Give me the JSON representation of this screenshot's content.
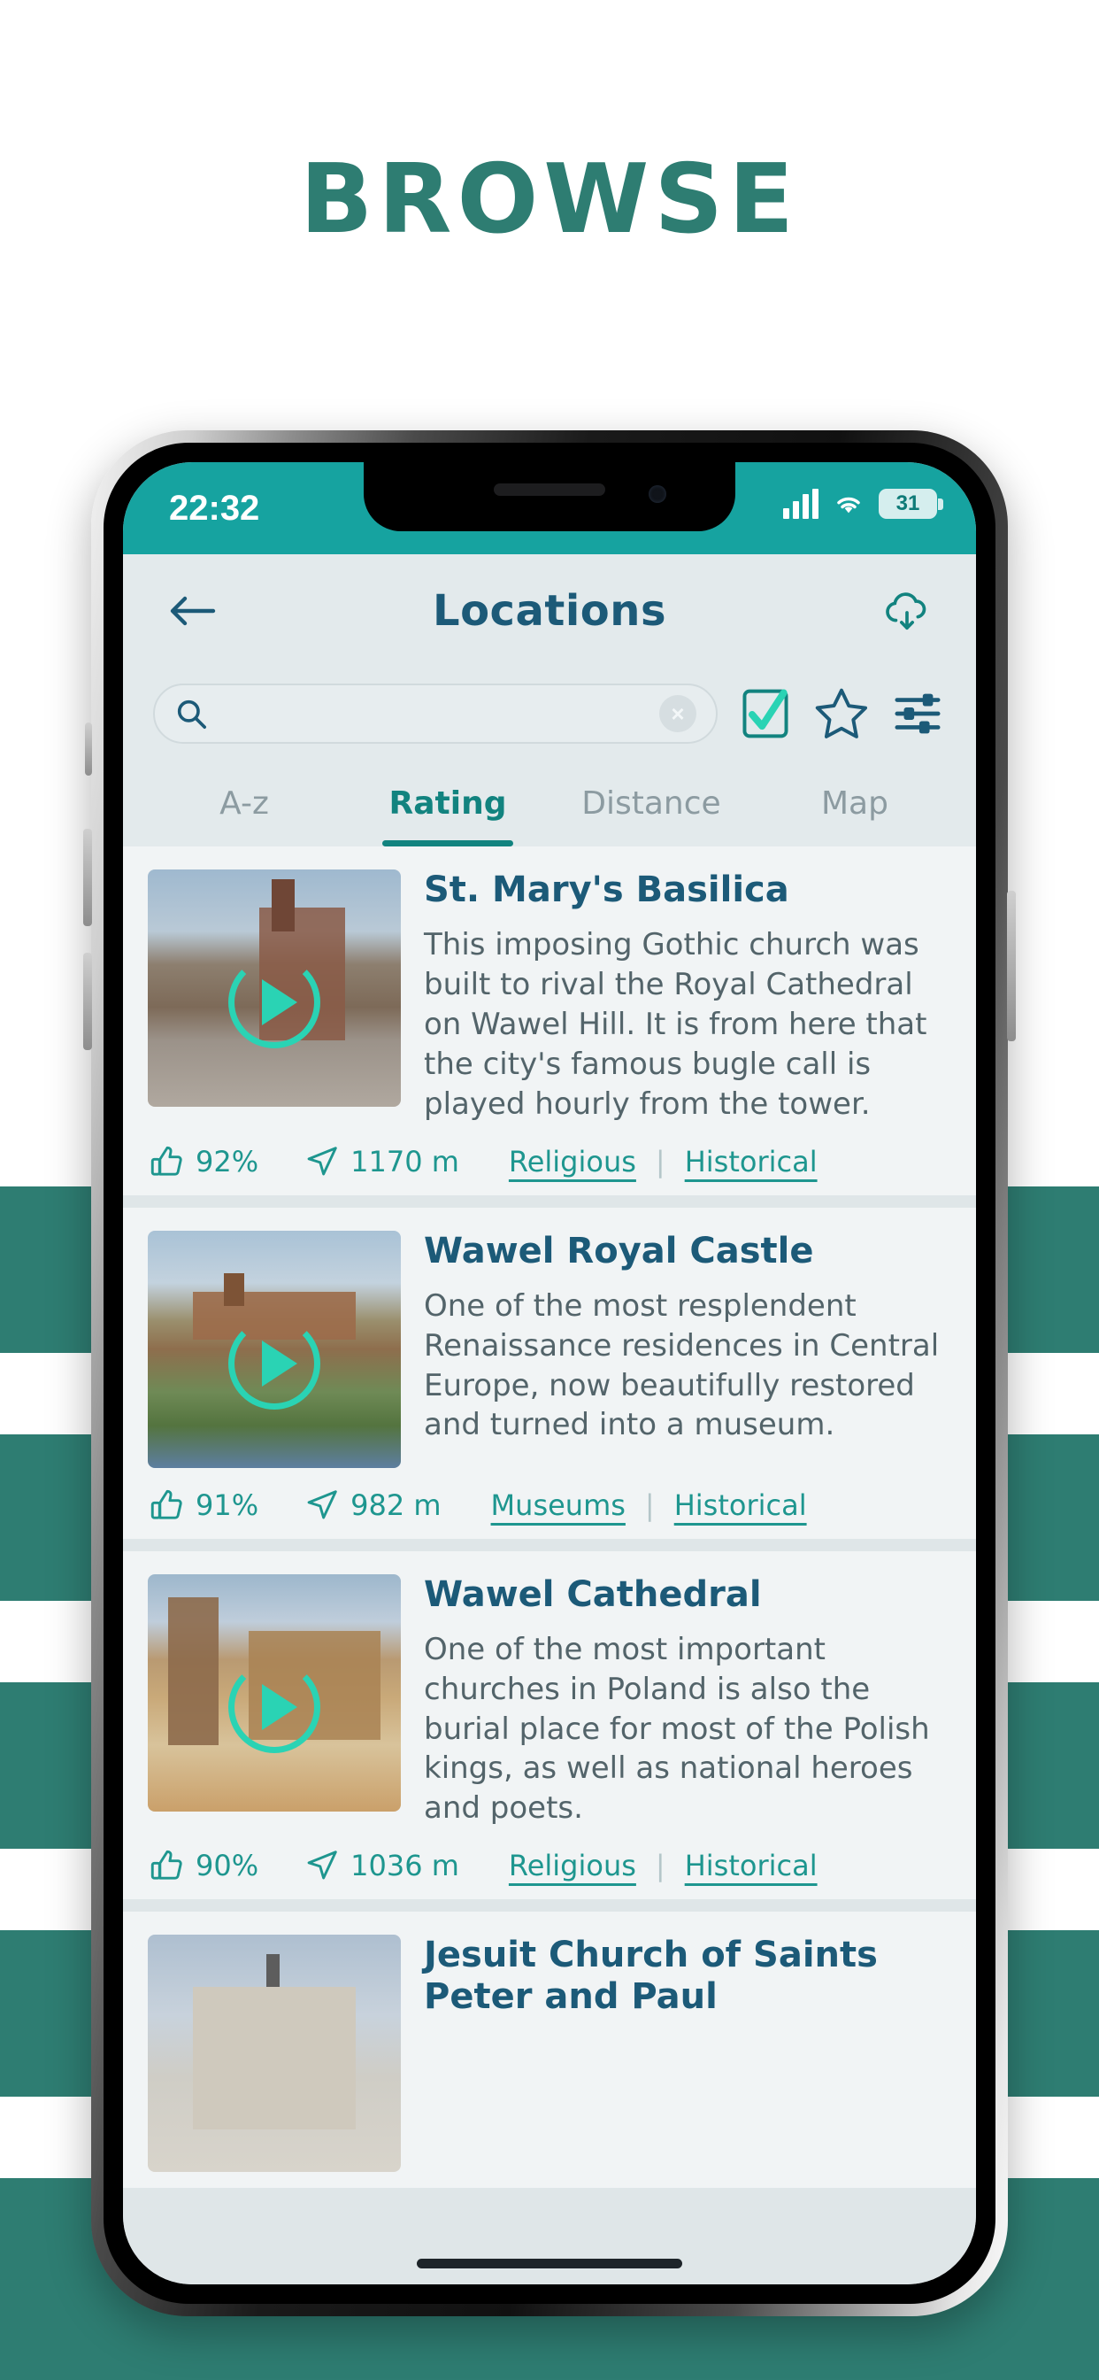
{
  "headline": "BROWSE",
  "theme": {
    "accent_teal": "#16a3a0",
    "dark_teal": "#2e7d72",
    "title_blue": "#1c5a78",
    "link_teal": "#1e968f",
    "screen_bg": "#e3eaec",
    "play_green": "#2ad3b4"
  },
  "status_bar": {
    "time": "22:32",
    "battery_level": "31",
    "signal_icon": "signal-bars-icon",
    "wifi_icon": "wifi-icon",
    "battery_icon": "battery-icon"
  },
  "app_bar": {
    "back_icon": "back-arrow-icon",
    "title": "Locations",
    "download_icon": "cloud-download-icon"
  },
  "search": {
    "value": "",
    "placeholder": "",
    "search_icon": "search-icon",
    "clear_label": "×",
    "actions": [
      {
        "name": "checkbox-checked-icon",
        "label": "Selected"
      },
      {
        "name": "star-outline-icon",
        "label": "Favourites"
      },
      {
        "name": "filter-sliders-icon",
        "label": "Filters"
      }
    ]
  },
  "tabs": [
    {
      "label": "A-z",
      "active": false
    },
    {
      "label": "Rating",
      "active": true
    },
    {
      "label": "Distance",
      "active": false
    },
    {
      "label": "Map",
      "active": false
    }
  ],
  "locations": [
    {
      "title": "St. Mary's Basilica",
      "description": "This imposing Gothic church was built to rival the Royal Cathedral on Wawel Hill. It is from here that the city's famous bugle call is played hourly from the tower.",
      "rating": "92%",
      "distance": "1170 m",
      "tags": [
        "Religious",
        "Historical"
      ],
      "thumb_alt": "st-marys-basilica-photo"
    },
    {
      "title": "Wawel Royal Castle",
      "description": "One of the most resplendent Renaissance residences in Central Europe, now beautifully restored and turned into a museum.",
      "rating": "91%",
      "distance": "982 m",
      "tags": [
        "Museums",
        "Historical"
      ],
      "thumb_alt": "wawel-royal-castle-photo"
    },
    {
      "title": "Wawel Cathedral",
      "description": "One of the most important churches in Poland is also the burial place for most of the Polish kings, as well as national heroes and poets.",
      "rating": "90%",
      "distance": "1036 m",
      "tags": [
        "Religious",
        "Historical"
      ],
      "thumb_alt": "wawel-cathedral-photo"
    },
    {
      "title": "Jesuit Church of Saints Peter and Paul",
      "description": "",
      "rating": "",
      "distance": "",
      "tags": [],
      "thumb_alt": "jesuit-church-photo"
    }
  ],
  "meta_icons": {
    "rating_icon": "thumbs-up-icon",
    "distance_icon": "navigation-arrow-icon",
    "play_icon": "play-circle-icon"
  }
}
